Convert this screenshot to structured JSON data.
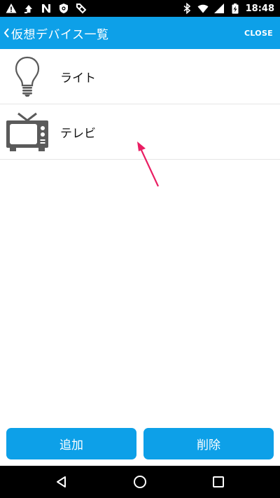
{
  "status_bar": {
    "time": "18:48",
    "left_icons": [
      "warning-icon",
      "sync-icon",
      "n-icon",
      "shield-icon",
      "tag-icon"
    ],
    "right_icons": [
      "bluetooth-icon",
      "wifi-icon",
      "signal-icon",
      "battery-icon"
    ]
  },
  "app_bar": {
    "title": "仮想デバイス一覧",
    "back_icon": "chevron-left-icon",
    "close_label": "CLOSE"
  },
  "devices": [
    {
      "label": "ライト",
      "icon": "lightbulb-icon"
    },
    {
      "label": "テレビ",
      "icon": "tv-icon"
    }
  ],
  "actions": {
    "add_label": "追加",
    "delete_label": "削除"
  },
  "nav_bar": {
    "icons": [
      "nav-back-icon",
      "nav-home-icon",
      "nav-recents-icon"
    ]
  },
  "colors": {
    "accent": "#0da0e8",
    "annotation": "#e91e63",
    "icon_gray": "#5a5a5a"
  }
}
